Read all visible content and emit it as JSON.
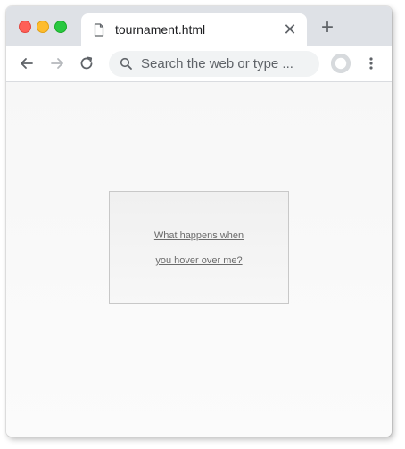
{
  "browser": {
    "tab": {
      "title": "tournament.html",
      "close_glyph": "✕",
      "file_icon": "file-icon"
    },
    "new_tab_glyph": "+",
    "toolbar": {
      "back_icon": "arrow-left-icon",
      "forward_icon": "arrow-right-icon",
      "reload_icon": "reload-icon",
      "omnibox_placeholder": "Search the web or type ...",
      "profile_icon": "profile-avatar-icon",
      "menu_icon": "kebab-menu-icon"
    }
  },
  "page": {
    "hover_box": {
      "line1": "What happens when",
      "line2": "you hover over me?"
    }
  },
  "colors": {
    "traffic_red": "#ff5f57",
    "traffic_yellow": "#febc2e",
    "traffic_green": "#28c840",
    "tabstrip_bg": "#dee1e6"
  }
}
